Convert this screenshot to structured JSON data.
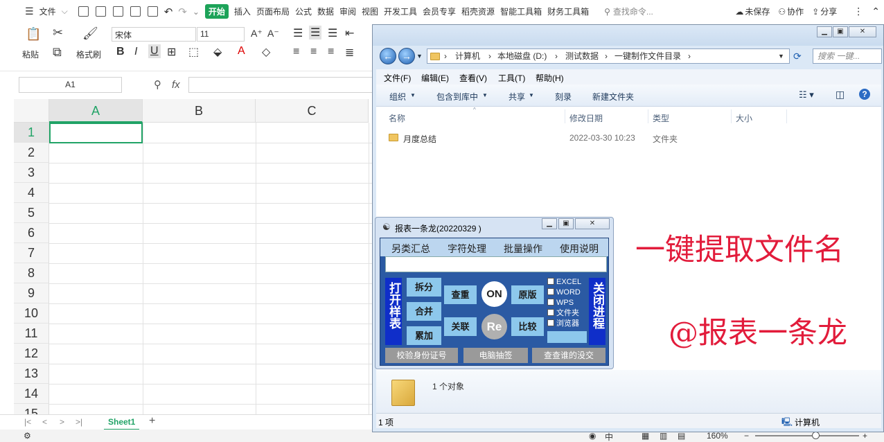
{
  "wps": {
    "menu": {
      "file": "文件",
      "tabs": [
        "开始",
        "插入",
        "页面布局",
        "公式",
        "数据",
        "审阅",
        "视图",
        "开发工具",
        "会员专享",
        "稻壳资源",
        "智能工具箱",
        "财务工具箱"
      ],
      "search": "查找命令...",
      "unsaved": "未保存",
      "collab": "协作",
      "share": "分享"
    },
    "ribbon": {
      "paste": "粘贴",
      "format_painter": "格式刷",
      "font_name": "宋体",
      "font_size": "11"
    },
    "formula": {
      "name_box": "A1",
      "fx": "fx"
    },
    "columns": [
      "A",
      "B",
      "C"
    ],
    "rows": [
      "1",
      "2",
      "3",
      "4",
      "5",
      "6",
      "7",
      "8",
      "9",
      "10",
      "11",
      "12",
      "13",
      "14",
      "15"
    ],
    "sheet_tab": "Sheet1",
    "zoom": "160%",
    "lang": "中"
  },
  "explorer": {
    "breadcrumb": [
      "计算机",
      "本地磁盘 (D:)",
      "测试数据",
      "一键制作文件目录"
    ],
    "search_placeholder": "搜索 一键...",
    "menu": [
      "文件(F)",
      "编辑(E)",
      "查看(V)",
      "工具(T)",
      "帮助(H)"
    ],
    "toolbar": [
      "组织",
      "包含到库中",
      "共享",
      "刻录",
      "新建文件夹"
    ],
    "columns": [
      "名称",
      "修改日期",
      "类型",
      "大小"
    ],
    "files": [
      {
        "name": "月度总结",
        "date": "2022-03-30 10:23",
        "type": "文件夹",
        "size": ""
      }
    ],
    "details": "1 个对象",
    "status_left": "1 项",
    "status_right": "计算机"
  },
  "dialog": {
    "title": "报表一条龙(20220329 )",
    "menu": [
      "另类汇总",
      "字符处理",
      "批量操作",
      "使用说明"
    ],
    "open_sample": "打开样表",
    "close_process": "关闭进程",
    "buttons": {
      "split": "拆分",
      "merge": "合并",
      "accumulate": "累加",
      "dedupe": "查重",
      "associate": "关联",
      "on": "ON",
      "re": "Re",
      "original": "原版",
      "compare": "比较"
    },
    "checkboxes": [
      "EXCEL",
      "WORD",
      "WPS",
      "文件夹",
      "浏览器"
    ],
    "bottom": [
      "校验身份证号",
      "电脑抽签",
      "查查谁的没交"
    ]
  },
  "overlay": {
    "headline": "一键提取文件名",
    "brand": "@报表一条龙"
  }
}
